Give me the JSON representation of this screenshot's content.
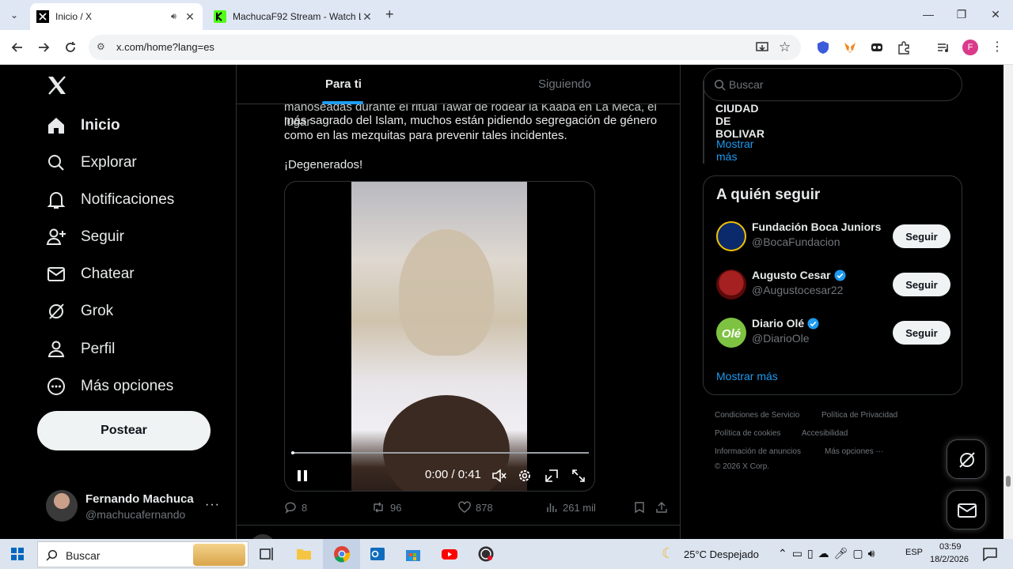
{
  "browser": {
    "tabs": [
      {
        "title": "Inicio / X",
        "active": true
      },
      {
        "title": "MachucaF92 Stream - Watch Li",
        "active": false
      }
    ],
    "url": "x.com/home?lang=es",
    "profile_initial": "F"
  },
  "sidebar": {
    "items": [
      {
        "label": "Inicio",
        "icon": "home-icon"
      },
      {
        "label": "Explorar",
        "icon": "search-icon"
      },
      {
        "label": "Notificaciones",
        "icon": "bell-icon"
      },
      {
        "label": "Seguir",
        "icon": "person-add-icon"
      },
      {
        "label": "Chatear",
        "icon": "mail-icon"
      },
      {
        "label": "Grok",
        "icon": "grok-icon"
      },
      {
        "label": "Perfil",
        "icon": "person-icon"
      },
      {
        "label": "Más opciones",
        "icon": "more-circle-icon"
      }
    ],
    "post_button": "Postear",
    "profile": {
      "name": "Fernando Machuca",
      "handle": "@machucafernando"
    }
  },
  "timeline": {
    "tabs": [
      "Para ti",
      "Siguiendo"
    ],
    "tweet_lines": [
      "manoseadas durante el ritual Tawaf de rodear la Kaaba en La Meca, el lugar",
      "más sagrado del Islam, muchos están pidiendo segregación de género",
      "como en las mezquitas para prevenir tales incidentes."
    ],
    "tweet_exclaim": "¡Degenerados!",
    "video": {
      "time": "0:00 / 0:41",
      "progress": 0.0
    },
    "actions": {
      "replies": "8",
      "reposts": "96",
      "likes": "878",
      "views": "261 mil"
    }
  },
  "right": {
    "search_placeholder": "Buscar",
    "trend_tail": "CIUDAD DE BOLIVAR",
    "show_more": "Mostrar más",
    "who_to_follow_title": "A quién seguir",
    "follow": [
      {
        "name": "Fundación Boca Juniors",
        "handle": "@BocaFundacion",
        "button": "Seguir",
        "verified": false
      },
      {
        "name": "Augusto Cesar",
        "handle": "@Augustocesar22",
        "button": "Seguir",
        "verified": true
      },
      {
        "name": "Diario Olé",
        "handle": "@DiarioOle",
        "button": "Seguir",
        "verified": true
      }
    ],
    "show_more_2": "Mostrar más",
    "footer": {
      "line1": [
        "Condiciones de Servicio",
        "Política de Privacidad"
      ],
      "line2": [
        "Política de cookies",
        "Accesibilidad"
      ],
      "line3": [
        "Información de anuncios",
        "Más opciones ···"
      ],
      "copyright": "© 2026 X Corp."
    }
  },
  "taskbar": {
    "search": "Buscar",
    "weather": "25°C  Despejado",
    "lang": "ESP",
    "time": "03:59",
    "date": "18/2/2026"
  }
}
